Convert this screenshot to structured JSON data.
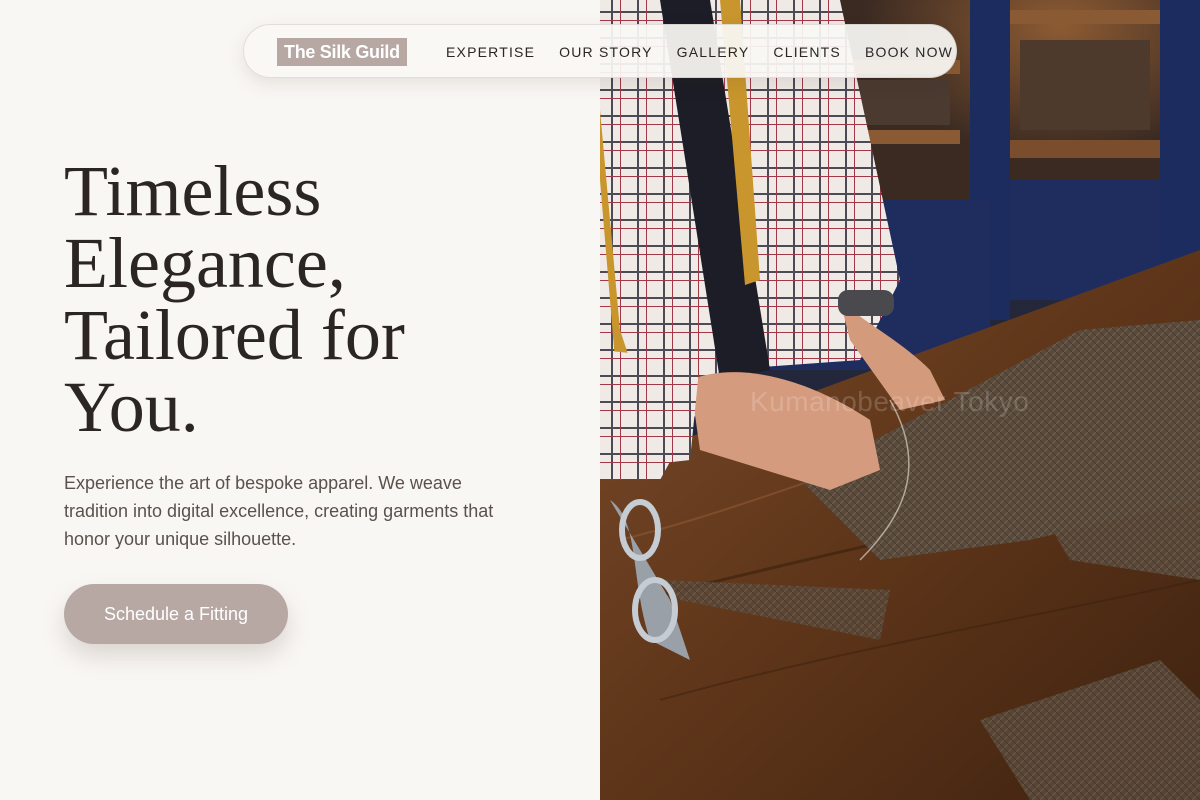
{
  "nav": {
    "brand": "The Silk Guild",
    "links": [
      "EXPERTISE",
      "OUR STORY",
      "GALLERY",
      "CLIENTS",
      "BOOK NOW"
    ]
  },
  "hero": {
    "title_lines": [
      "Timeless",
      "Elegance,",
      "Tailored for",
      "You."
    ],
    "subtitle": "Experience the art of bespoke apparel. We weave tradition into digital excellence, creating garments that honor your unique silhouette.",
    "cta_label": "Schedule a Fitting"
  },
  "photo": {
    "watermark": "Kumanobeaver Tokyo"
  },
  "colors": {
    "accent": "#b7a8a3",
    "background": "#f9f7f4",
    "text": "#2b2623",
    "muted_text": "#5b514c"
  }
}
